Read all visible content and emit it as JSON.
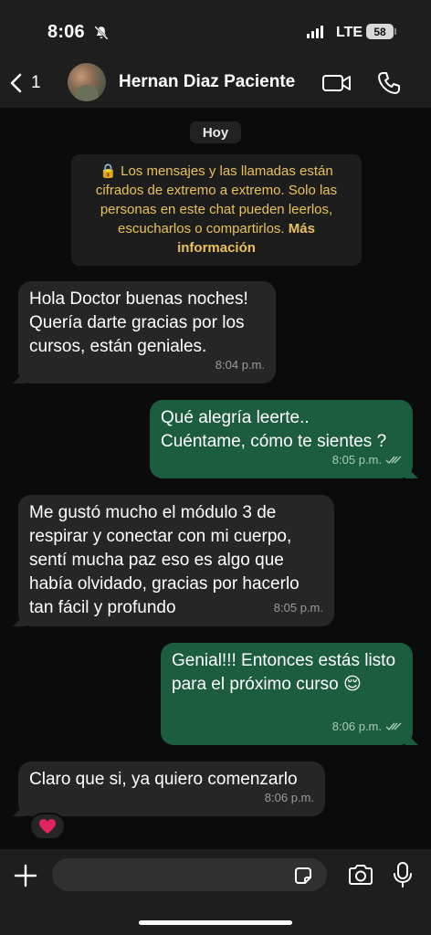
{
  "status_bar": {
    "time": "8:06",
    "network": "LTE",
    "battery": "58"
  },
  "header": {
    "back_count": "1",
    "contact_name": "Hernan Diaz Paciente"
  },
  "chat": {
    "date_chip": "Hoy",
    "notice": {
      "text": "🔒 Los mensajes y las llamadas están cifrados de extremo a extremo. Solo las personas en este chat pueden leerlos, escucharlos o compartirlos.",
      "link": "Más información"
    },
    "messages": [
      {
        "direction": "incoming",
        "text": "Hola Doctor buenas noches! Quería darte gracias por los cursos, están geniales.",
        "time": "8:04 p.m."
      },
      {
        "direction": "outgoing",
        "text": "Qué alegría leerte.. Cuéntame, cómo te sientes ?",
        "time": "8:05 p.m.",
        "status": "read"
      },
      {
        "direction": "incoming",
        "text": "Me gustó mucho el módulo 3 de respirar y conectar con mi cuerpo, sentí mucha paz eso es algo que había olvidado, gracias por hacerlo tan fácil y profundo",
        "time": "8:05 p.m."
      },
      {
        "direction": "outgoing",
        "text": "Genial!!! Entonces estás listo para el próximo curso 😌",
        "time": "8:06 p.m.",
        "status": "read"
      },
      {
        "direction": "incoming",
        "text": "Claro que si, ya quiero comenzarlo",
        "time": "8:06 p.m.",
        "reaction": "❤️"
      }
    ]
  },
  "composer": {
    "input_value": "",
    "icons": [
      "plus-icon",
      "sticker-icon",
      "camera-icon",
      "mic-icon"
    ]
  },
  "colors": {
    "incoming_bubble": "#262626",
    "outgoing_bubble": "#1c5d40",
    "notice_text": "#e8c15a",
    "background": "#0b0b0b"
  }
}
